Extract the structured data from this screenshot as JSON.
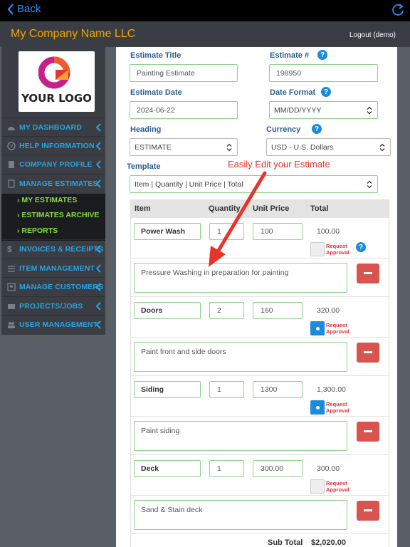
{
  "topbar": {
    "back_label": "Back"
  },
  "header": {
    "company_name": "My Company Name LLC",
    "logout_label": "Logout (demo)"
  },
  "logo": {
    "text": "YOUR LOGO"
  },
  "sidebar": {
    "items": [
      {
        "label": "MY DASHBOARD"
      },
      {
        "label": "HELP INFORMATION"
      },
      {
        "label": "COMPANY PROFILE"
      },
      {
        "label": "MANAGE ESTIMATES"
      },
      {
        "label": "INVOICES & RECEIPTS"
      },
      {
        "label": "ITEM MANAGEMENT"
      },
      {
        "label": "MANAGE CUSTOMERS"
      },
      {
        "label": "PROJECTS/JOBS"
      },
      {
        "label": "USER MANAGEMENT"
      }
    ],
    "subitems": [
      {
        "label": "› MY ESTIMATES"
      },
      {
        "label": "› ESTIMATES ARCHIVE"
      },
      {
        "label": "› REPORTS"
      }
    ]
  },
  "form": {
    "estimate_title_label": "Estimate Title",
    "estimate_title_value": "Painting Estimate",
    "estimate_num_label": "Estimate #",
    "estimate_num_value": "198950",
    "estimate_date_label": "Estimate Date",
    "estimate_date_value": "2024-06-22",
    "date_format_label": "Date Format",
    "date_format_value": "MM/DD/YYYY",
    "heading_label": "Heading",
    "heading_value": "ESTIMATE",
    "currency_label": "Currency",
    "currency_value": "USD - U.S. Dollars",
    "template_label": "Template",
    "template_value": "Item | Quantity | Unit Price | Total"
  },
  "annotation": "Easily Edit your Estimate",
  "table": {
    "headers": {
      "item": "Item",
      "quantity": "Quantity",
      "unit_price": "Unit Price",
      "total": "Total"
    },
    "request_approval": "Request Approval",
    "rows": [
      {
        "item": "Power Wash",
        "qty": "1",
        "price": "100",
        "total": "100.00",
        "approval": false,
        "desc": "Pressure Washing in preparation for painting"
      },
      {
        "item": "Doors",
        "qty": "2",
        "price": "160",
        "total": "320.00",
        "approval": true,
        "desc": "Paint front and side doors"
      },
      {
        "item": "Siding",
        "qty": "1",
        "price": "1300",
        "total": "1,300.00",
        "approval": true,
        "desc": "Paint siding"
      },
      {
        "item": "Deck",
        "qty": "1",
        "price": "300.00",
        "total": "300.00",
        "approval": false,
        "desc": "Sand & Stain deck"
      }
    ],
    "subtotal_label": "Sub Total",
    "subtotal_value": "$2,020.00"
  },
  "colors": {
    "accent": "#2ba3e0",
    "brand": "#f0a500",
    "submenu": "#8ad94a",
    "danger": "#d9534f",
    "annotation": "#e8332e"
  }
}
